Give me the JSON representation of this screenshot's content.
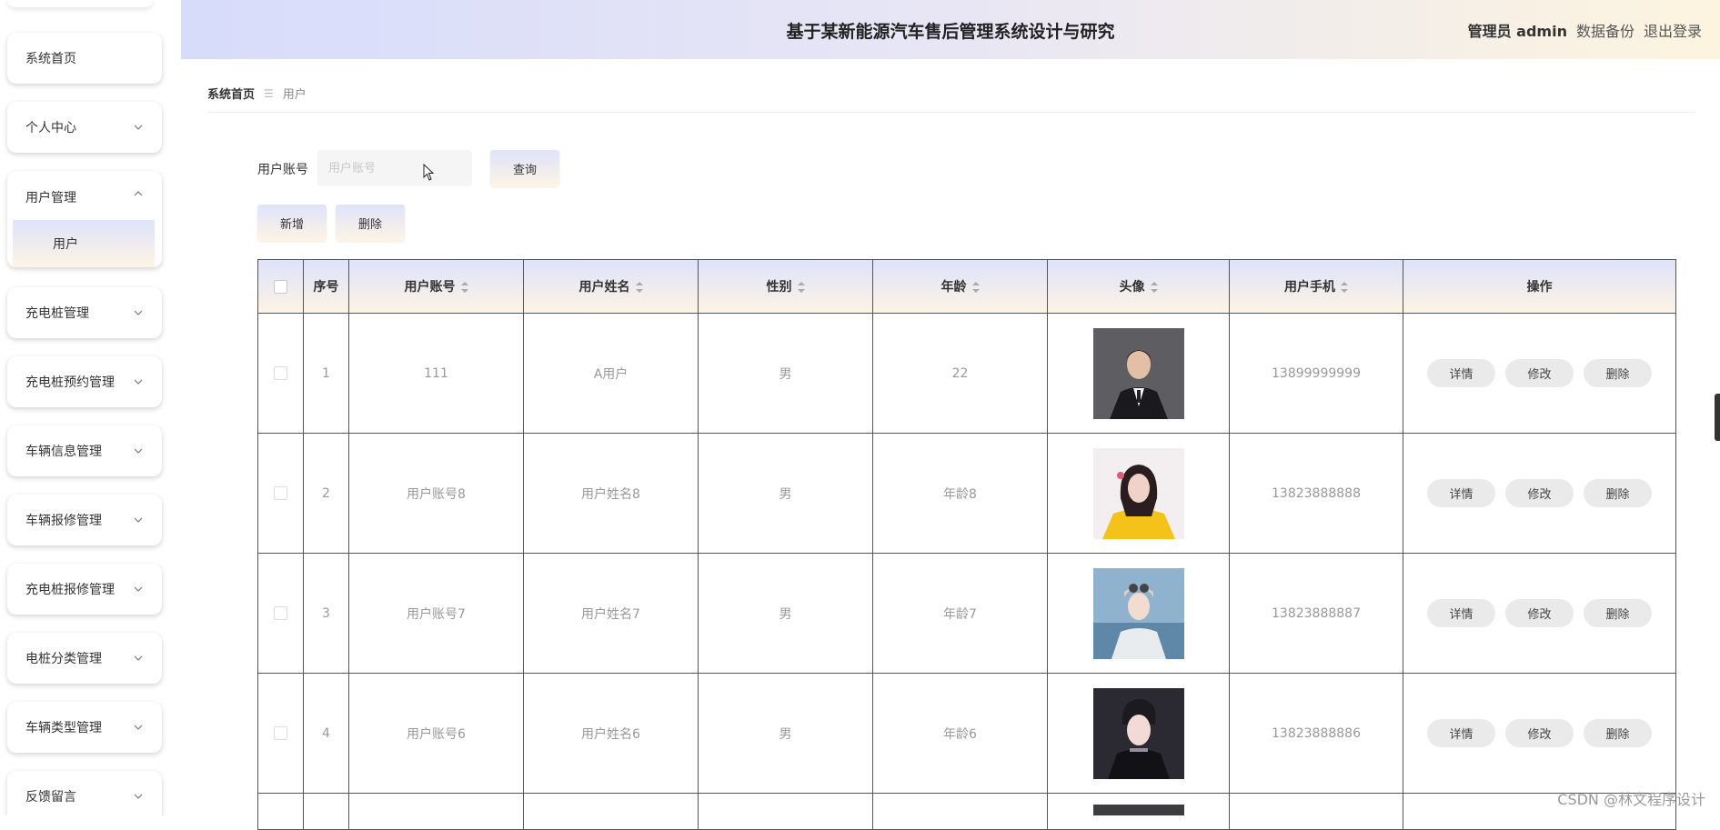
{
  "header": {
    "title": "基于某新能源汽车售后管理系统设计与研究",
    "admin_label": "管理员 admin",
    "backup_label": "数据备份",
    "logout_label": "退出登录"
  },
  "sidebar": {
    "items": [
      {
        "label": "系统首页"
      },
      {
        "label": "个人中心"
      },
      {
        "label": "用户管理"
      },
      {
        "label": "充电桩管理"
      },
      {
        "label": "充电桩预约管理"
      },
      {
        "label": "车辆信息管理"
      },
      {
        "label": "车辆报修管理"
      },
      {
        "label": "充电桩报修管理"
      },
      {
        "label": "电桩分类管理"
      },
      {
        "label": "车辆类型管理"
      },
      {
        "label": "反馈留言"
      }
    ],
    "submenu_label": "用户"
  },
  "breadcrumb": {
    "home": "系统首页",
    "current": "用户"
  },
  "search": {
    "label": "用户账号",
    "placeholder": "用户账号",
    "query_label": "查询"
  },
  "actions": {
    "add_label": "新增",
    "delete_label": "删除"
  },
  "table": {
    "headers": [
      "序号",
      "用户账号",
      "用户姓名",
      "性别",
      "年龄",
      "头像",
      "用户手机",
      "操作"
    ],
    "rows": [
      {
        "no": "1",
        "account": "111",
        "name": "A用户",
        "gender": "男",
        "age": "22",
        "phone": "13899999999"
      },
      {
        "no": "2",
        "account": "用户账号8",
        "name": "用户姓名8",
        "gender": "男",
        "age": "年龄8",
        "phone": "13823888888"
      },
      {
        "no": "3",
        "account": "用户账号7",
        "name": "用户姓名7",
        "gender": "男",
        "age": "年龄7",
        "phone": "13823888887"
      },
      {
        "no": "4",
        "account": "用户账号6",
        "name": "用户姓名6",
        "gender": "男",
        "age": "年龄6",
        "phone": "13823888886"
      }
    ],
    "op_labels": {
      "detail": "详情",
      "edit": "修改",
      "delete": "删除"
    }
  },
  "watermark": "CSDN @林文程序设计",
  "colors": {
    "header_start": "#d7dcfb",
    "header_end": "#fdf4df",
    "button_gradient_start": "#dfe3fb",
    "button_gradient_end": "#fdf4e4"
  }
}
